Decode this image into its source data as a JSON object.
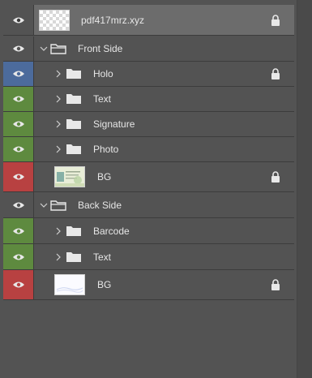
{
  "layers": [
    {
      "id": "pdf417",
      "name": "pdf417mrz.xyz",
      "kind": "image",
      "thumb": "checker-transparent",
      "indent": 0,
      "eye_color": "none",
      "locked": true,
      "selected": true
    },
    {
      "id": "front-side",
      "name": "Front Side",
      "kind": "group",
      "expanded": true,
      "indent": 0,
      "eye_color": "none",
      "locked": false
    },
    {
      "id": "holo",
      "name": "Holo",
      "kind": "group",
      "expanded": false,
      "indent": 1,
      "eye_color": "#4c6b9c",
      "locked": true
    },
    {
      "id": "text-front",
      "name": "Text",
      "kind": "group",
      "expanded": false,
      "indent": 1,
      "eye_color": "#5e8a3f",
      "locked": false
    },
    {
      "id": "signature",
      "name": "Signature",
      "kind": "group",
      "expanded": false,
      "indent": 1,
      "eye_color": "#5e8a3f",
      "locked": false
    },
    {
      "id": "photo",
      "name": "Photo",
      "kind": "group",
      "expanded": false,
      "indent": 1,
      "eye_color": "#5e8a3f",
      "locked": false
    },
    {
      "id": "bg-front",
      "name": "BG",
      "kind": "image",
      "thumb": "id-card-front",
      "indent": 1,
      "eye_color": "#b84141",
      "locked": true
    },
    {
      "id": "back-side",
      "name": "Back Side",
      "kind": "group",
      "expanded": true,
      "indent": 0,
      "eye_color": "none",
      "locked": false
    },
    {
      "id": "barcode",
      "name": "Barcode",
      "kind": "group",
      "expanded": false,
      "indent": 1,
      "eye_color": "#5e8a3f",
      "locked": false
    },
    {
      "id": "text-back",
      "name": "Text",
      "kind": "group",
      "expanded": false,
      "indent": 1,
      "eye_color": "#5e8a3f",
      "locked": false
    },
    {
      "id": "bg-back",
      "name": "BG",
      "kind": "image",
      "thumb": "id-card-back",
      "indent": 1,
      "eye_color": "#b84141",
      "locked": true
    }
  ],
  "icons": {
    "visibility": "eye-icon",
    "lock": "lock-icon",
    "folder": "folder-icon",
    "expand": "chevron-icon"
  }
}
